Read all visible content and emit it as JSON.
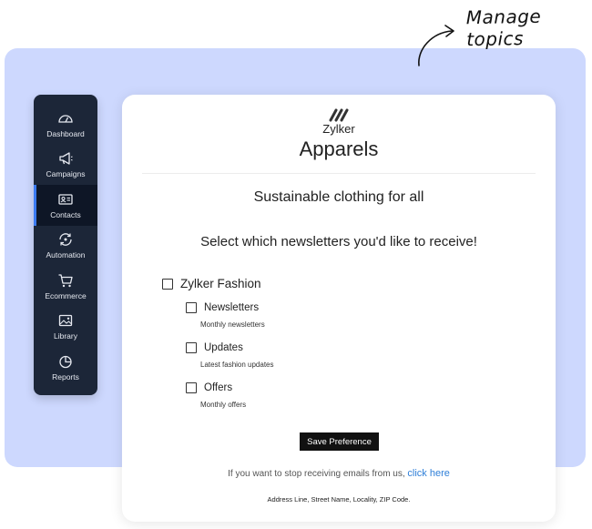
{
  "callout": {
    "text": "Manage topics"
  },
  "sidebar": {
    "items": [
      {
        "label": "Dashboard",
        "icon": "dashboard-icon",
        "active": false
      },
      {
        "label": "Campaigns",
        "icon": "megaphone-icon",
        "active": false
      },
      {
        "label": "Contacts",
        "icon": "contact-card-icon",
        "active": true
      },
      {
        "label": "Automation",
        "icon": "automation-icon",
        "active": false
      },
      {
        "label": "Ecommerce",
        "icon": "cart-icon",
        "active": false
      },
      {
        "label": "Library",
        "icon": "image-icon",
        "active": false
      },
      {
        "label": "Reports",
        "icon": "pie-chart-icon",
        "active": false
      }
    ]
  },
  "brand": {
    "name": "Zylker",
    "subtitle": "Apparels"
  },
  "tagline": "Sustainable clothing for all",
  "prompt": "Select which newsletters you'd like to receive!",
  "topics": {
    "group_label": "Zylker Fashion",
    "items": [
      {
        "label": "Newsletters",
        "description": "Monthly newsletters"
      },
      {
        "label": "Updates",
        "description": "Latest fashion updates"
      },
      {
        "label": "Offers",
        "description": "Monthly offers"
      }
    ]
  },
  "save_button": {
    "label": "Save Preference"
  },
  "unsubscribe": {
    "text": "If you want to stop receiving emails from us,",
    "link": "click here"
  },
  "footer": {
    "address": "Address Line, Street Name, Locality, ZIP Code."
  },
  "colors": {
    "background_panel": "#cdd8fe",
    "sidebar": "#1c2638",
    "accent": "#3c7bf2",
    "link": "#2f7fd8"
  }
}
